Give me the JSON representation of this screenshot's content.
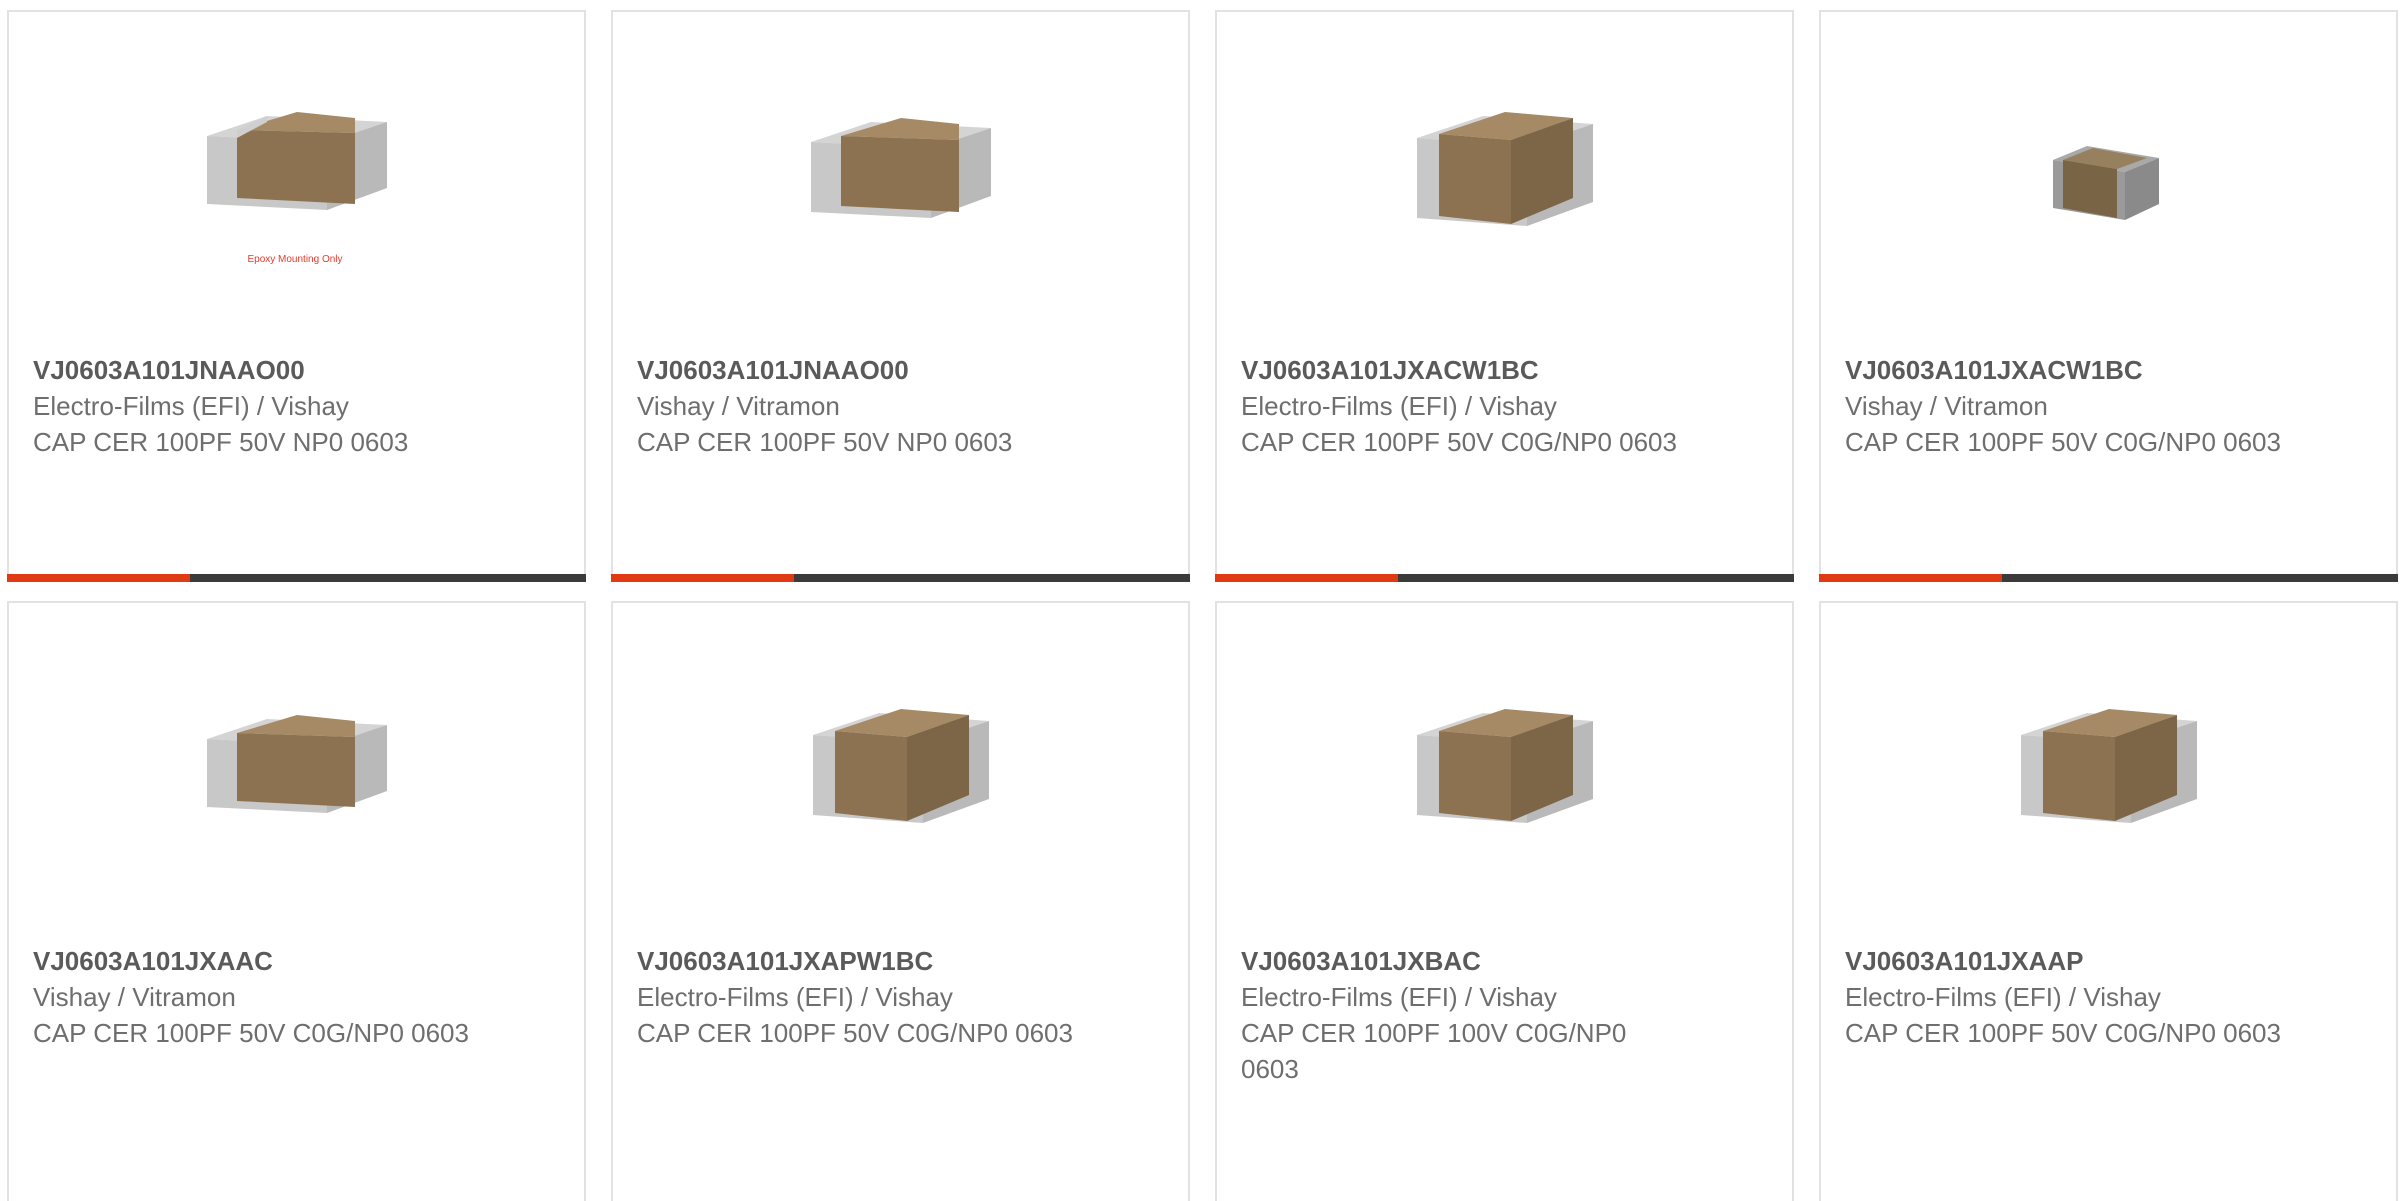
{
  "products": [
    {
      "part_number": "VJ0603A101JNAAO00",
      "manufacturer": "Electro-Films (EFI) / Vishay",
      "description": "CAP CER 100PF 50V NP0 0603",
      "image_icon": "capacitor-epoxy-icon",
      "image_caption": "Epoxy Mounting Only"
    },
    {
      "part_number": "VJ0603A101JNAAO00",
      "manufacturer": "Vishay / Vitramon",
      "description": "CAP CER 100PF 50V NP0 0603",
      "image_icon": "capacitor-icon"
    },
    {
      "part_number": "VJ0603A101JXACW1BC",
      "manufacturer": "Electro-Films (EFI) / Vishay",
      "description": "CAP CER 100PF 50V C0G/NP0 0603",
      "image_icon": "capacitor-icon"
    },
    {
      "part_number": "VJ0603A101JXACW1BC",
      "manufacturer": "Vishay / Vitramon",
      "description": "CAP CER 100PF 50V C0G/NP0 0603",
      "image_icon": "capacitor-small-icon"
    },
    {
      "part_number": "VJ0603A101JXAAC",
      "manufacturer": "Vishay / Vitramon",
      "description": "CAP CER 100PF 50V C0G/NP0 0603",
      "image_icon": "capacitor-icon"
    },
    {
      "part_number": "VJ0603A101JXAPW1BC",
      "manufacturer": "Electro-Films (EFI) / Vishay",
      "description": "CAP CER 100PF 50V C0G/NP0 0603",
      "image_icon": "capacitor-icon"
    },
    {
      "part_number": "VJ0603A101JXBAC",
      "manufacturer": "Electro-Films (EFI) / Vishay",
      "description": "CAP CER 100PF 100V C0G/NP0 0603",
      "image_icon": "capacitor-icon"
    },
    {
      "part_number": "VJ0603A101JXAAP",
      "manufacturer": "Electro-Films (EFI) / Vishay",
      "description": "CAP CER 100PF 50V C0G/NP0 0603",
      "image_icon": "capacitor-icon"
    }
  ],
  "colors": {
    "accent": "#e03a14",
    "bar": "#3b3b3b",
    "border": "#e2e2e2",
    "text_bold": "#5a5a5a",
    "text": "#6e6e6e"
  }
}
